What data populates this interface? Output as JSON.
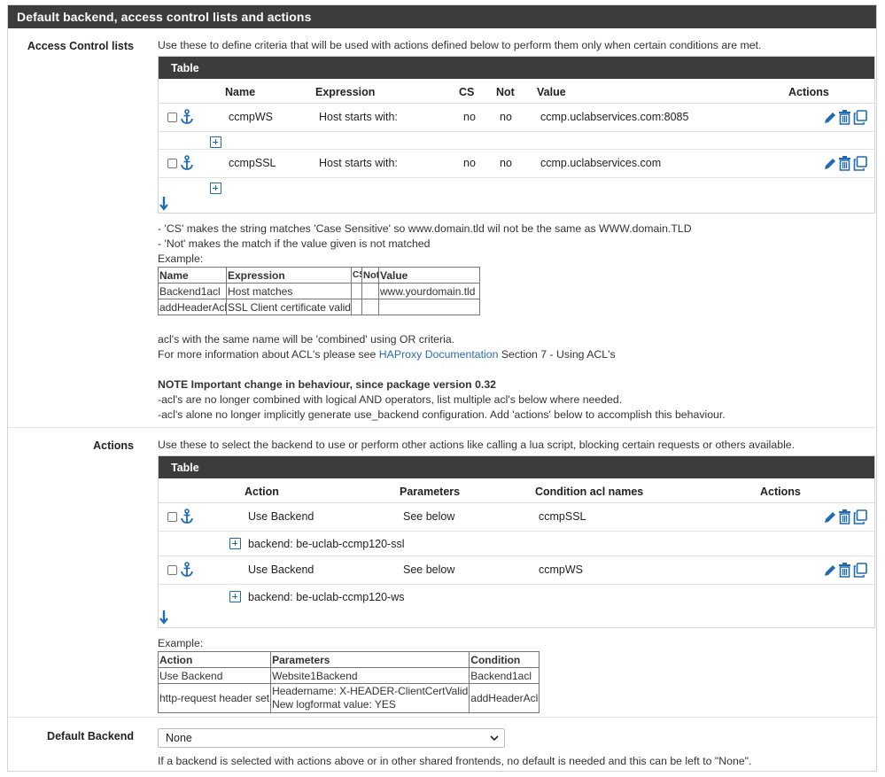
{
  "panel": {
    "title": "Default backend, access control lists and actions"
  },
  "acl_section": {
    "label": "Access Control lists",
    "description": "Use these to define criteria that will be used with actions defined below to perform them only when certain conditions are met.",
    "table_title": "Table",
    "columns": [
      "Name",
      "Expression",
      "CS",
      "Not",
      "Value",
      "Actions"
    ],
    "rows": [
      {
        "name": "ccmpWS",
        "expression": "Host starts with:",
        "cs": "no",
        "not": "no",
        "value": "ccmp.uclabservices.com:8085"
      },
      {
        "name": "ccmpSSL",
        "expression": "Host starts with:",
        "cs": "no",
        "not": "no",
        "value": "ccmp.uclabservices.com"
      }
    ],
    "notes": [
      "- 'CS' makes the string matches 'Case Sensitive' so www.domain.tld wil not be the same as WWW.domain.TLD",
      "- 'Not' makes the match if the value given is not matched"
    ],
    "example_label": "Example:",
    "example_columns": [
      "Name",
      "Expression",
      "CS",
      "Not",
      "Value"
    ],
    "example_rows": [
      [
        "Backend1acl",
        "Host matches",
        "",
        "",
        "www.yourdomain.tld"
      ],
      [
        "addHeaderAcl",
        "SSL Client certificate valid",
        "",
        "",
        ""
      ]
    ],
    "combined_text": "acl's with the same name will be 'combined' using OR criteria.",
    "more_info_prefix": "For more information about ACL's please see ",
    "more_info_link": "HAProxy Documentation",
    "more_info_suffix": " Section 7 - Using ACL's",
    "note_title": "NOTE Important change in behaviour, since package version 0.32",
    "note_lines": [
      "-acl's are no longer combined with logical AND operators, list multiple acl's below where needed.",
      "-acl's alone no longer implicitly generate use_backend configuration. Add 'actions' below to accomplish this behaviour."
    ]
  },
  "actions_section": {
    "label": "Actions",
    "description": "Use these to select the backend to use or perform other actions like calling a lua script, blocking certain requests or others available.",
    "table_title": "Table",
    "columns": [
      "Action",
      "Parameters",
      "Condition acl names",
      "Actions"
    ],
    "rows": [
      {
        "action": "Use Backend",
        "parameters": "See below",
        "condition": "ccmpSSL",
        "detail": "backend: be-uclab-ccmp120-ssl"
      },
      {
        "action": "Use Backend",
        "parameters": "See below",
        "condition": "ccmpWS",
        "detail": "backend: be-uclab-ccmp120-ws"
      }
    ],
    "example_label": "Example:",
    "example_columns": [
      "Action",
      "Parameters",
      "Condition"
    ],
    "example_rows": [
      {
        "action": "Use Backend",
        "param1": "Website1Backend",
        "param2": "",
        "condition": "Backend1acl"
      },
      {
        "action": "http-request header set",
        "param1": "Headername: X-HEADER-ClientCertValid",
        "param2": "New logformat value: YES",
        "condition": "addHeaderAcl"
      }
    ]
  },
  "default_backend": {
    "label": "Default Backend",
    "selected": "None",
    "help": "If a backend is selected with actions above or in other shared frontends, no default is needed and this can be left to \"None\"."
  },
  "icons": {
    "anchor": "anchor-icon",
    "edit": "pencil-icon",
    "delete": "trash-icon",
    "copy": "copy-icon",
    "add": "plus-square-icon",
    "move": "arrow-down-icon",
    "accent_color": "#1f6bb3",
    "header_bg": "#3c3c3c"
  }
}
